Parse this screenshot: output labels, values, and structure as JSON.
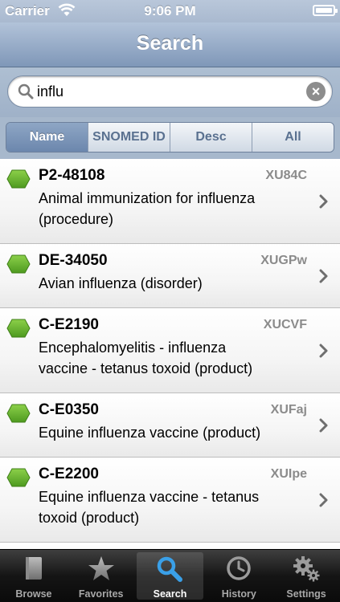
{
  "status_bar": {
    "carrier": "Carrier",
    "time": "9:06 PM"
  },
  "nav": {
    "title": "Search"
  },
  "search": {
    "query": "influ",
    "placeholder": ""
  },
  "segments": [
    {
      "label": "Name",
      "selected": true
    },
    {
      "label": "SNOMED ID",
      "selected": false
    },
    {
      "label": "Desc",
      "selected": false
    },
    {
      "label": "All",
      "selected": false
    }
  ],
  "results": [
    {
      "code": "P2-48108",
      "concept_id": "XU84C",
      "line1": "Animal immunization for influenza",
      "line2": "(procedure)"
    },
    {
      "code": "DE-34050",
      "concept_id": "XUGPw",
      "line1": "Avian influenza (disorder)",
      "line2": ""
    },
    {
      "code": "C-E2190",
      "concept_id": "XUCVF",
      "line1": "Encephalomyelitis - influenza",
      "line2": "vaccine - tetanus toxoid (product)"
    },
    {
      "code": "C-E0350",
      "concept_id": "XUFaj",
      "line1": "Equine influenza vaccine (product)",
      "line2": ""
    },
    {
      "code": "C-E2200",
      "concept_id": "XUIpe",
      "line1": "Equine influenza vaccine - tetanus",
      "line2": "toxoid (product)"
    }
  ],
  "tabs": [
    {
      "label": "Browse",
      "icon": "book-icon"
    },
    {
      "label": "Favorites",
      "icon": "star-icon"
    },
    {
      "label": "Search",
      "icon": "search-icon"
    },
    {
      "label": "History",
      "icon": "clock-icon"
    },
    {
      "label": "Settings",
      "icon": "gear-icon"
    }
  ],
  "colors": {
    "status_green": "#6aab2e",
    "nav_blue": "#7f97b8",
    "tab_selected_blue": "#3aa0e8"
  }
}
